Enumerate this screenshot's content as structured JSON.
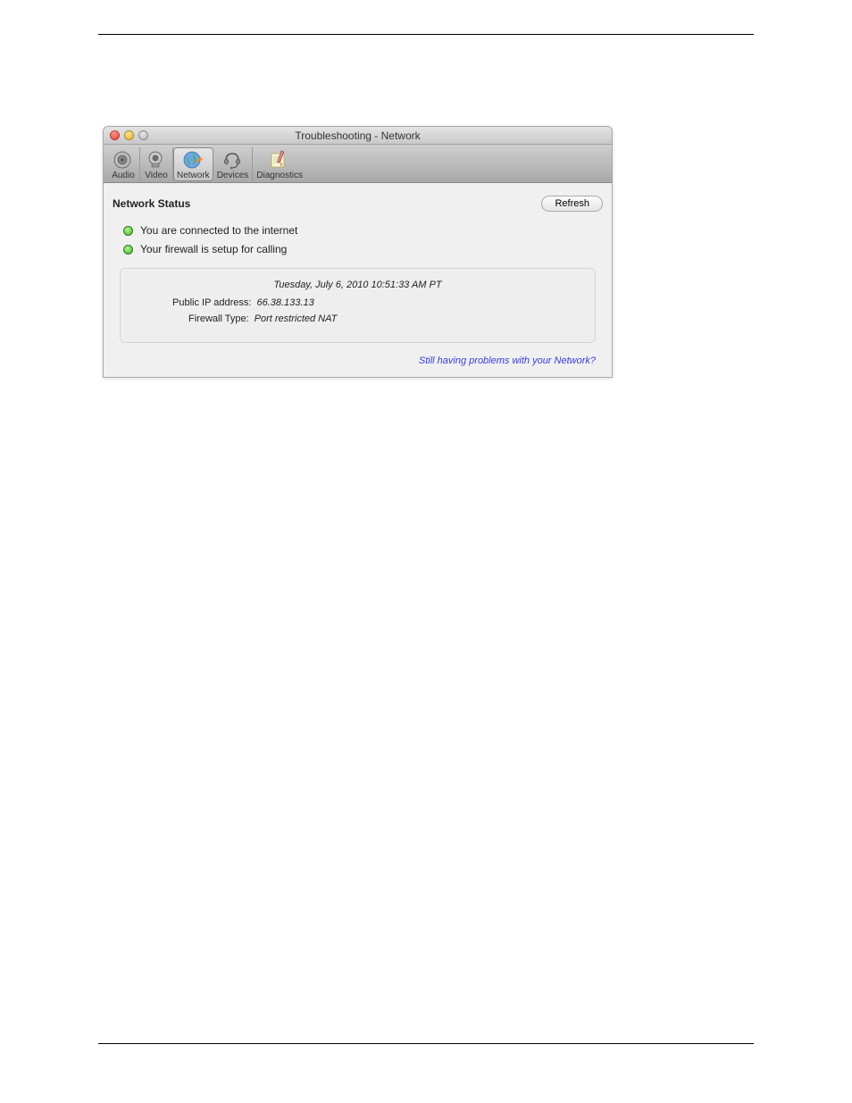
{
  "window": {
    "title": "Troubleshooting - Network"
  },
  "toolbar": {
    "items": [
      {
        "label": "Audio"
      },
      {
        "label": "Video"
      },
      {
        "label": "Network"
      },
      {
        "label": "Devices"
      },
      {
        "label": "Diagnostics"
      }
    ]
  },
  "section": {
    "heading": "Network Status",
    "refresh_label": "Refresh"
  },
  "status": {
    "items": [
      {
        "text": "You are connected to the internet"
      },
      {
        "text": "Your firewall is setup for calling"
      }
    ]
  },
  "details": {
    "timestamp": "Tuesday, July 6, 2010 10:51:33 AM PT",
    "rows": [
      {
        "label": "Public IP address:",
        "value": "66.38.133.13"
      },
      {
        "label": "Firewall Type:",
        "value": "Port restricted NAT"
      }
    ]
  },
  "help_link": "Still having problems with your Network?"
}
